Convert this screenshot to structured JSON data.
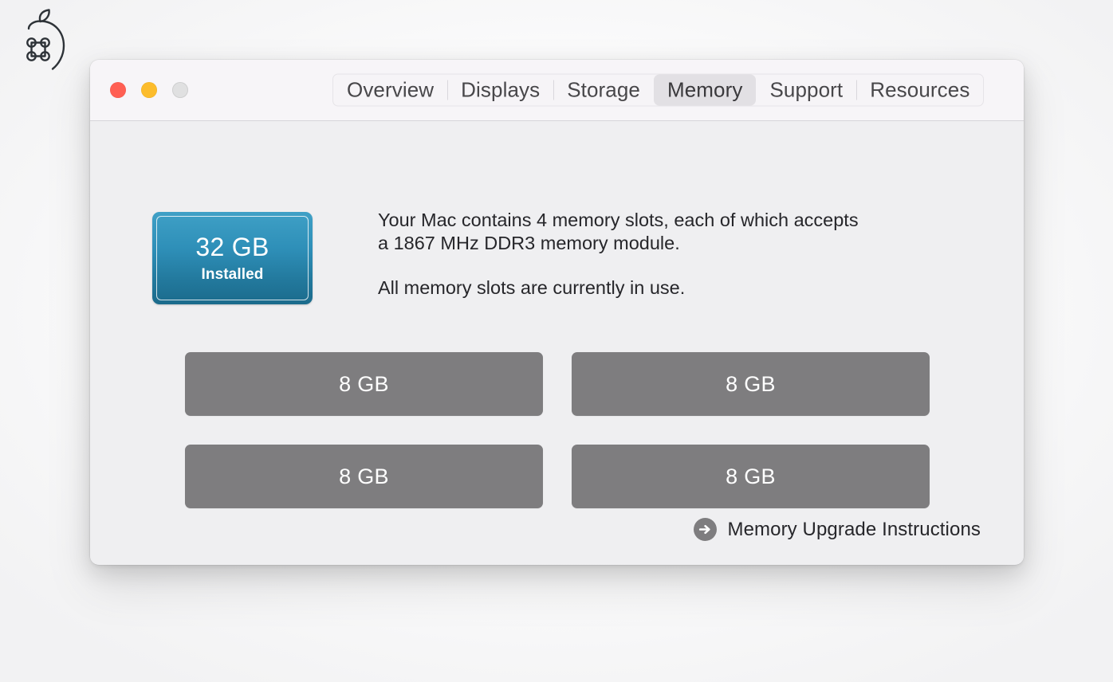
{
  "desktop": {
    "logo_icon": "apple-command-logo-icon"
  },
  "window": {
    "traffic_lights": {
      "close_label": "close-window",
      "minimize_label": "minimize-window",
      "zoom_label": "zoom-window"
    },
    "tabs": [
      {
        "label": "Overview",
        "selected": false
      },
      {
        "label": "Displays",
        "selected": false
      },
      {
        "label": "Storage",
        "selected": false
      },
      {
        "label": "Memory",
        "selected": true
      },
      {
        "label": "Support",
        "selected": false
      },
      {
        "label": "Resources",
        "selected": false
      }
    ]
  },
  "memory": {
    "badge": {
      "size": "32 GB",
      "state": "Installed",
      "accent_color": "#2e8fb8"
    },
    "description_line_1": "Your Mac contains 4 memory slots, each of which accepts",
    "description_line_2": "a 1867 MHz DDR3 memory module.",
    "description_line_3": "All memory slots are currently in use.",
    "slot_color": "#7e7d7f",
    "slots": [
      {
        "capacity": "8 GB"
      },
      {
        "capacity": "8 GB"
      },
      {
        "capacity": "8 GB"
      },
      {
        "capacity": "8 GB"
      }
    ],
    "upgrade_link": {
      "label": "Memory Upgrade Instructions",
      "icon": "arrow-right-circle-icon"
    }
  }
}
